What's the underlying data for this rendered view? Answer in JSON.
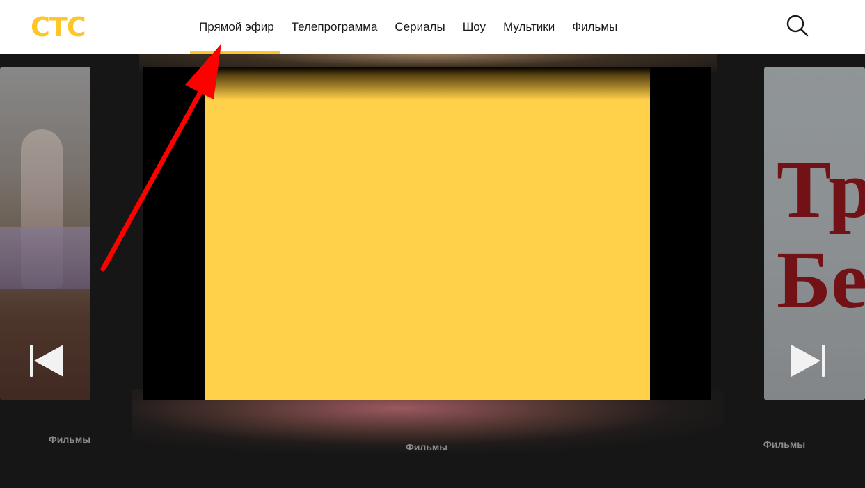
{
  "header": {
    "logo_text": "СТС",
    "nav": [
      {
        "label": "Прямой эфир",
        "active": true
      },
      {
        "label": "Телепрограмма",
        "active": false
      },
      {
        "label": "Сериалы",
        "active": false
      },
      {
        "label": "Шоу",
        "active": false
      },
      {
        "label": "Мультики",
        "active": false
      },
      {
        "label": "Фильмы",
        "active": false
      }
    ],
    "search_icon": "search-icon"
  },
  "carousel": {
    "left_caption": "Фильмы",
    "center_caption": "Фильмы",
    "right_caption": "Фильмы",
    "right_poster_lines": [
      "Тр",
      "Бе"
    ],
    "prev_icon": "skip-previous-icon",
    "next_icon": "skip-next-icon"
  },
  "colors": {
    "brand_yellow": "#ffc629",
    "video_yellow": "#ffd04a",
    "annotation_red": "#ff0000"
  }
}
